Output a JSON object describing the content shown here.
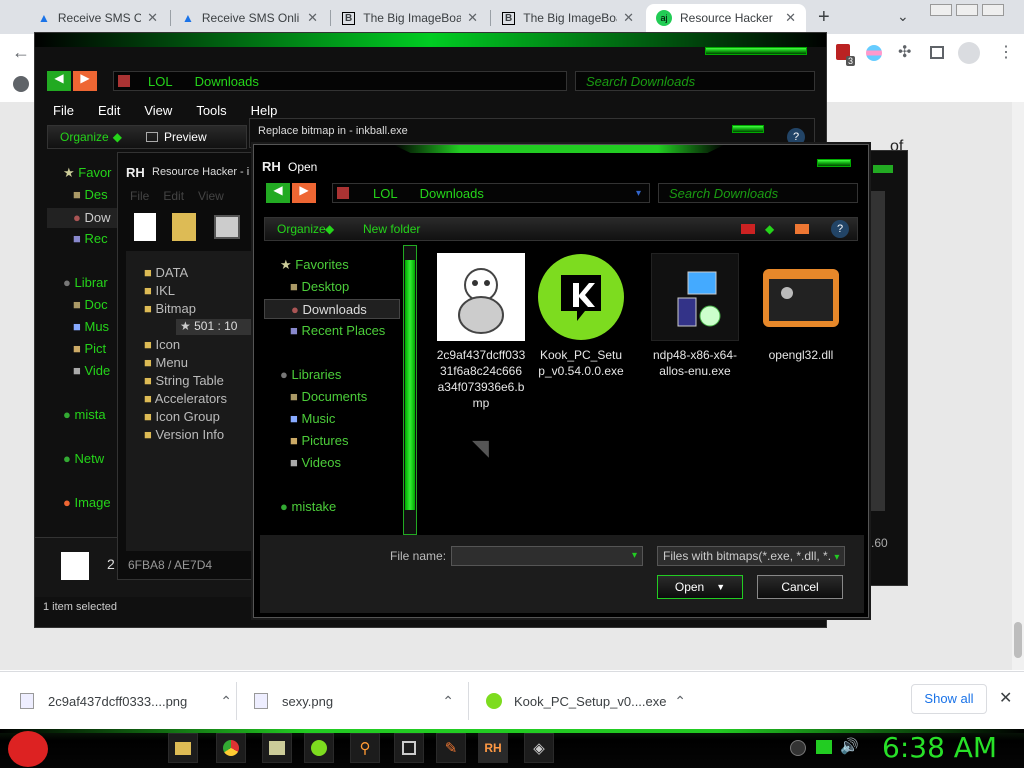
{
  "browser": {
    "tabs": [
      {
        "title": "Receive SMS Onli",
        "icon": "triangle-icon"
      },
      {
        "title": "Receive SMS Onli",
        "icon": "triangle-icon"
      },
      {
        "title": "The Big ImageBoa",
        "icon": "b-icon"
      },
      {
        "title": "The Big ImageBoa",
        "icon": "b-icon"
      },
      {
        "title": "Resource Hacker",
        "icon": "rh-icon",
        "active": true
      }
    ],
    "ext_badge": "3"
  },
  "explorer_back": {
    "address": {
      "part1": "LOL",
      "part2": "Downloads"
    },
    "search_placeholder": "Search Downloads",
    "menu": [
      "File",
      "Edit",
      "View",
      "Tools",
      "Help"
    ],
    "toolbar": {
      "organize": "Organize",
      "preview": "Preview"
    },
    "nav": [
      "Favor",
      "Des",
      "Dow",
      "Rec",
      "Librar",
      "Doc",
      "Mus",
      "Pict",
      "Vide",
      "mista",
      "Netw",
      "Image"
    ],
    "status": "1 item selected",
    "details_count": "2",
    "right_value": ".60"
  },
  "replace_bitmap": {
    "title": "Replace bitmap in - inkball.exe"
  },
  "resource_hacker": {
    "title": "Resource Hacker - i",
    "menu": [
      "File",
      "Edit",
      "View"
    ],
    "tree": [
      "DATA",
      "IKL",
      "Bitmap",
      "501 : 10",
      "Icon",
      "Menu",
      "String Table",
      "Accelerators",
      "Icon Group",
      "Version Info"
    ],
    "status": "6FBA8 / AE7D4"
  },
  "open_dialog": {
    "title": "Open",
    "address": {
      "part1": "LOL",
      "part2": "Downloads"
    },
    "search_placeholder": "Search Downloads",
    "toolbar": {
      "organize": "Organize",
      "new_folder": "New folder"
    },
    "nav": [
      {
        "label": "Favorites",
        "icon": "star-icon"
      },
      {
        "label": "Desktop",
        "icon": "desktop-icon"
      },
      {
        "label": "Downloads",
        "icon": "downloads-icon"
      },
      {
        "label": "Recent Places",
        "icon": "recent-icon"
      },
      {
        "label": "Libraries",
        "icon": "libraries-icon"
      },
      {
        "label": "Documents",
        "icon": "documents-icon"
      },
      {
        "label": "Music",
        "icon": "music-icon"
      },
      {
        "label": "Pictures",
        "icon": "pictures-icon"
      },
      {
        "label": "Videos",
        "icon": "videos-icon"
      },
      {
        "label": "mistake",
        "icon": "globe-icon"
      }
    ],
    "files": [
      {
        "name": "2c9af437dcff033 31f6a8c24c666 a34f073936e6.b mp",
        "icon": "cartoon-thumbnail"
      },
      {
        "name": "Kook_PC_Setu p_v0.54.0.0.exe",
        "icon": "kook-logo-icon"
      },
      {
        "name": "ndp48-x86-x64- allos-enu.exe",
        "icon": "installer-icon"
      },
      {
        "name": "opengl32.dll",
        "icon": "window-icon"
      }
    ],
    "filename_label": "File name:",
    "filename_value": "",
    "filter": "Files with bitmaps(*.exe, *.dll, *.",
    "open_button": "Open",
    "cancel_button": "Cancel"
  },
  "downloads_bar": {
    "items": [
      {
        "name": "2c9af437dcff0333....png",
        "icon": "file-icon"
      },
      {
        "name": "sexy.png",
        "icon": "file-icon"
      },
      {
        "name": "Kook_PC_Setup_v0....exe",
        "icon": "kook-logo-icon"
      }
    ],
    "show_all": "Show all"
  },
  "taskbar": {
    "clock": "6:38 AM",
    "apps": [
      "folder-icon",
      "chrome-icon",
      "paint-icon",
      "kook-logo-icon",
      "search-icon",
      "network-icon",
      "brush-icon",
      "rh-icon",
      "game-icon"
    ]
  },
  "colors": {
    "accent_green": "#25d41a",
    "dialog_bg": "#000000",
    "clock": "#28e028"
  }
}
